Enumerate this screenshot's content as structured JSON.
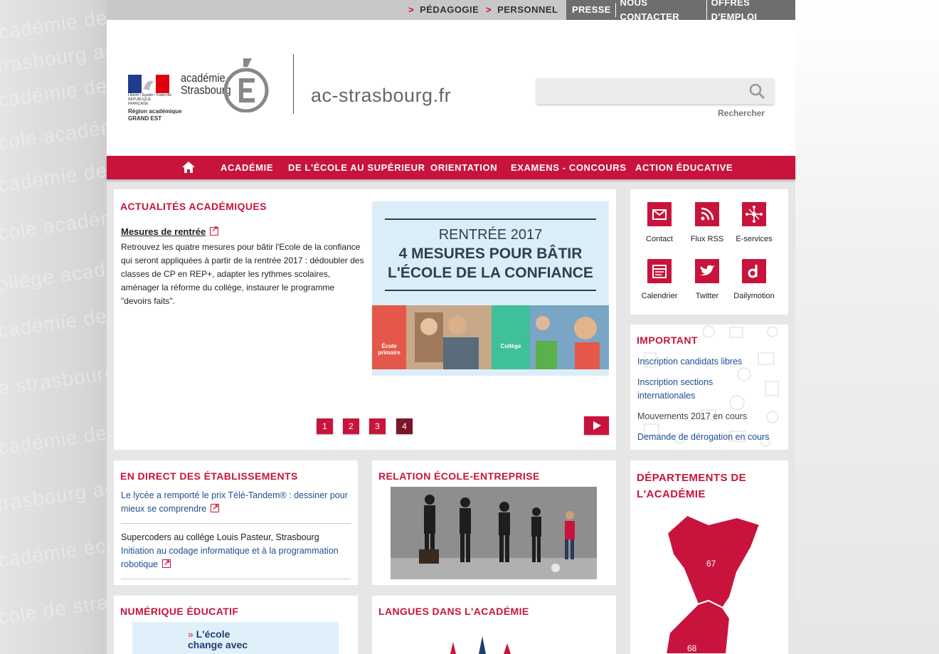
{
  "topbar": {
    "links": [
      "PÉDAGOGIE",
      "PERSONNEL"
    ],
    "dark_links": [
      "PRESSE",
      "NOUS CONTACTER",
      "OFFRES D'EMPLOI"
    ]
  },
  "header": {
    "rf_text": "Liberté • Égalité • Fraternité RÉPUBLIQUE FRANÇAISE",
    "region_line1": "Région académique",
    "region_line2": "GRAND EST",
    "logo_word1": "académie",
    "logo_word2": "Strasbourg",
    "domain": "ac-strasbourg.fr",
    "search_placeholder": "",
    "search_label": "Rechercher"
  },
  "nav": {
    "items": [
      "ACADÉMIE",
      "DE L'ÉCOLE AU SUPÉRIEUR",
      "ORIENTATION",
      "EXAMENS - CONCOURS",
      "ACTION ÉDUCATIVE"
    ]
  },
  "news": {
    "title": "ACTUALITÉS ACADÉMIQUES",
    "item_title": "Mesures de rentrée",
    "item_text": "Retrouvez les quatre mesures pour bâtir l'Ecole de la confiance qui seront appliquées à partir de la rentrée 2017 : dédoubler des classes de CP en REP+, adapter les rythmes scolaires, aménager la réforme du collège, instaurer le programme \"devoirs faits\".",
    "visual_line1": "RENTRÉE 2017",
    "visual_line2": "4 MESURES POUR BÂTIR",
    "visual_line3": "L'ÉCOLE DE LA CONFIANCE",
    "visual_tag1": "École primaire",
    "visual_tag2": "Collège",
    "pages": [
      "1",
      "2",
      "3",
      "4"
    ],
    "active_page": "4"
  },
  "quick_links": [
    {
      "label": "Contact",
      "icon": "mail-icon"
    },
    {
      "label": "Flux RSS",
      "icon": "rss-icon"
    },
    {
      "label": "E-services",
      "icon": "network-icon"
    },
    {
      "label": "Calendrier",
      "icon": "calendar-icon"
    },
    {
      "label": "Twitter",
      "icon": "twitter-icon"
    },
    {
      "label": "Dailymotion",
      "icon": "dailymotion-icon"
    }
  ],
  "important": {
    "title": "IMPORTANT",
    "links": [
      "Inscription candidats libres",
      "Inscription sections internationales",
      "Mouvements 2017 en cours",
      "Demande de dérogation en cours"
    ]
  },
  "direct": {
    "title": "EN DIRECT DES ÉTABLISSEMENTS",
    "item1": "Le lycée a remporté le prix Télé-Tandem® : dessiner pour mieux se comprendre",
    "item2_title": "Supercoders au collège Louis Pasteur, Strasbourg",
    "item2_link": "Initiation au codage informatique et à la programmation robotique"
  },
  "relation": {
    "title": "RELATION ÉCOLE-ENTREPRISE"
  },
  "depts": {
    "title_line1": "DÉPARTEMENTS DE",
    "title_line2": "L'ACADÉMIE",
    "dept1": "67",
    "dept2": "68"
  },
  "numeric": {
    "title": "NUMÉRIQUE ÉDUCATIF",
    "promo_line1": "L'école",
    "promo_line2": "change avec"
  },
  "langues": {
    "title": "LANGUES DANS L'ACADÉMIE"
  },
  "colors": {
    "brand_red": "#c8143c",
    "link_blue": "#1d4f8f",
    "active_page": "#7a1628"
  }
}
